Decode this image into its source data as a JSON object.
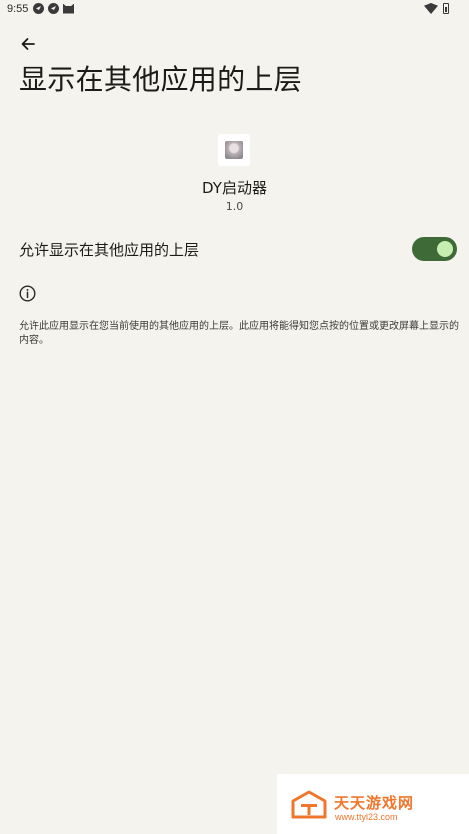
{
  "status_bar": {
    "time": "9:55"
  },
  "header": {
    "title": "显示在其他应用的上层"
  },
  "app": {
    "name": "DY启动器",
    "version": "1.0"
  },
  "setting": {
    "label": "允许显示在其他应用的上层",
    "enabled": true
  },
  "info": {
    "text": "允许此应用显示在您当前使用的其他应用的上层。此应用将能得知您点按的位置或更改屏幕上显示的内容。"
  },
  "watermark": {
    "title": "天天游戏网",
    "url": "www.ttyl23.com"
  },
  "colors": {
    "background": "#f4f3ee",
    "toggle_track": "#3e6a37",
    "toggle_thumb": "#c6eeb0",
    "watermark_accent": "#f0762c"
  }
}
